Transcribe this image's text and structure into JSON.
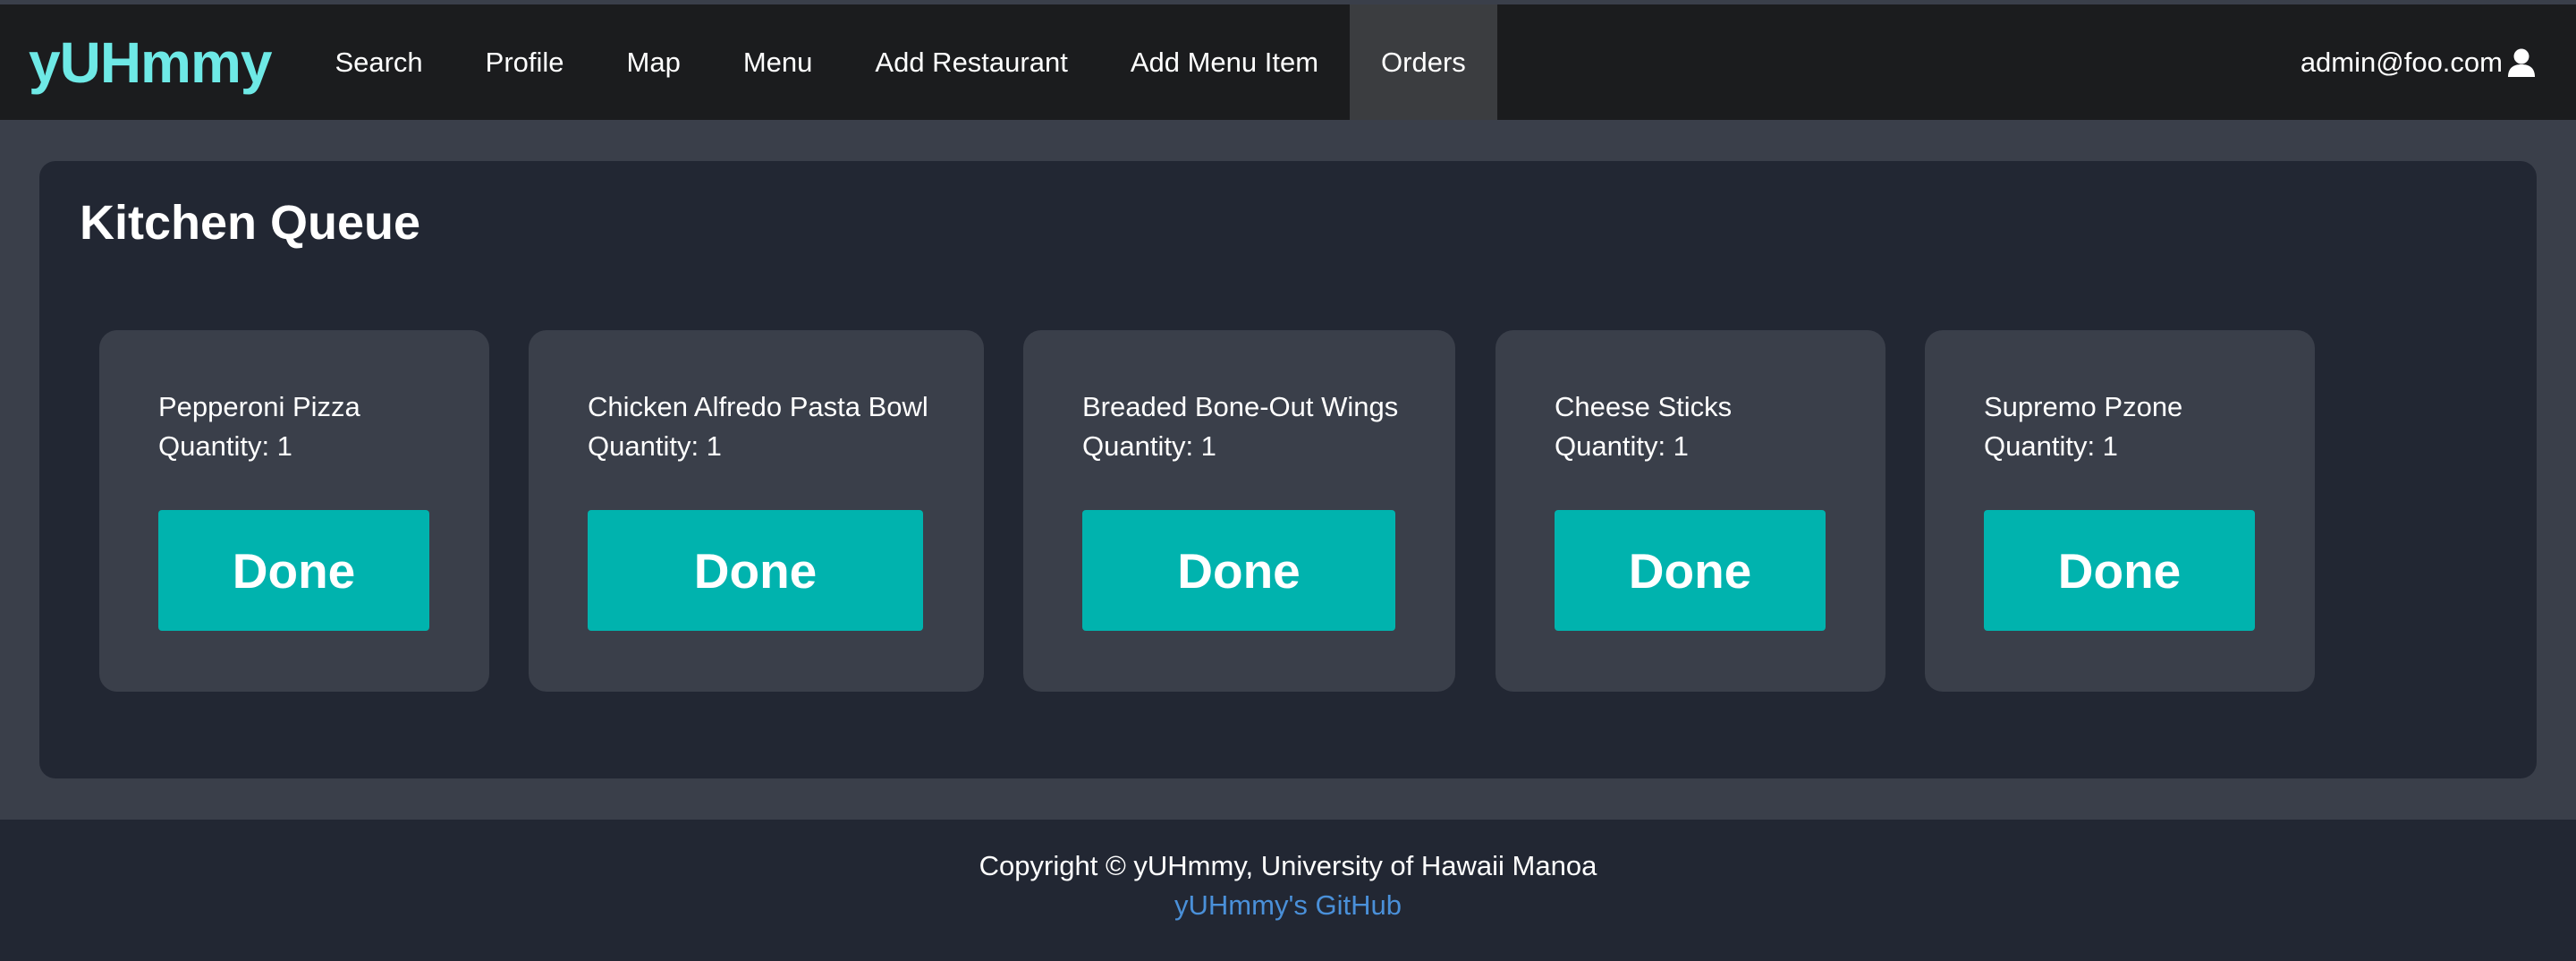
{
  "navbar": {
    "brand": "yUHmmy",
    "items": [
      {
        "label": "Search"
      },
      {
        "label": "Profile"
      },
      {
        "label": "Map"
      },
      {
        "label": "Menu"
      },
      {
        "label": "Add Restaurant"
      },
      {
        "label": "Add Menu Item"
      },
      {
        "label": "Orders",
        "active": true
      }
    ],
    "user_email": "admin@foo.com",
    "user_icon": "user-icon"
  },
  "main": {
    "title": "Kitchen Queue",
    "orders": [
      {
        "name": "Pepperoni Pizza",
        "quantity": "Quantity: 1",
        "button": "Done"
      },
      {
        "name": "Chicken Alfredo Pasta Bowl",
        "quantity": "Quantity: 1",
        "button": "Done"
      },
      {
        "name": "Breaded Bone-Out Wings",
        "quantity": "Quantity: 1",
        "button": "Done"
      },
      {
        "name": "Cheese Sticks",
        "quantity": "Quantity: 1",
        "button": "Done"
      },
      {
        "name": "Supremo Pzone",
        "quantity": "Quantity: 1",
        "button": "Done"
      }
    ]
  },
  "footer": {
    "copyright": "Copyright © yUHmmy, University of Hawaii Manoa",
    "github_link": "yUHmmy's GitHub"
  },
  "colors": {
    "brand": "#6ee9e6",
    "navbar_bg": "#1b1c1e",
    "page_bg": "#3a3f4a",
    "panel_bg": "#222733",
    "card_bg": "#3a3f4a",
    "button_bg": "#00b3ae",
    "link": "#4a90d9"
  }
}
